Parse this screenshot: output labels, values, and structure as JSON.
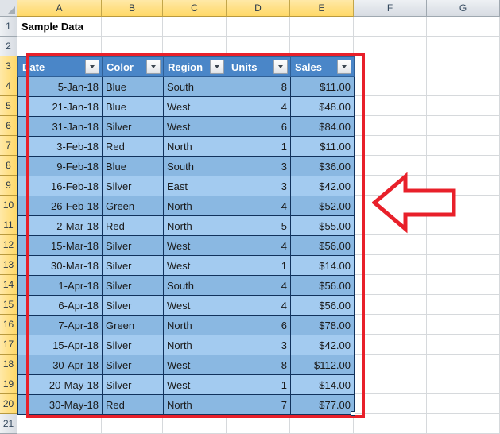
{
  "app": {
    "kind": "spreadsheet",
    "select_all_icon": "select-all-triangle-icon"
  },
  "grid": {
    "column_headers": [
      "A",
      "B",
      "C",
      "D",
      "E",
      "F",
      "G"
    ],
    "selected_columns": [
      "A",
      "B",
      "C",
      "D",
      "E"
    ],
    "row_headers": [
      "1",
      "2",
      "3",
      "4",
      "5",
      "6",
      "7",
      "8",
      "9",
      "10",
      "11",
      "12",
      "13",
      "14",
      "15",
      "16",
      "17",
      "18",
      "19",
      "20",
      "21"
    ],
    "selected_rows": [
      "3",
      "4",
      "5",
      "6",
      "7",
      "8",
      "9",
      "10",
      "11",
      "12",
      "13",
      "14",
      "15",
      "16",
      "17",
      "18",
      "19",
      "20"
    ]
  },
  "title_cell": {
    "ref": "A1",
    "text": "Sample Data"
  },
  "table": {
    "range": "A3:E20",
    "headers": [
      "Date",
      "Color",
      "Region",
      "Units",
      "Sales"
    ],
    "filter_icon": "filter-dropdown-icon",
    "rows": [
      {
        "row": "4",
        "date": "5-Jan-18",
        "color": "Blue",
        "region": "South",
        "units": "8",
        "sales": "$11.00"
      },
      {
        "row": "5",
        "date": "21-Jan-18",
        "color": "Blue",
        "region": "West",
        "units": "4",
        "sales": "$48.00"
      },
      {
        "row": "6",
        "date": "31-Jan-18",
        "color": "Silver",
        "region": "West",
        "units": "6",
        "sales": "$84.00"
      },
      {
        "row": "7",
        "date": "3-Feb-18",
        "color": "Red",
        "region": "North",
        "units": "1",
        "sales": "$11.00"
      },
      {
        "row": "8",
        "date": "9-Feb-18",
        "color": "Blue",
        "region": "South",
        "units": "3",
        "sales": "$36.00"
      },
      {
        "row": "9",
        "date": "16-Feb-18",
        "color": "Silver",
        "region": "East",
        "units": "3",
        "sales": "$42.00"
      },
      {
        "row": "10",
        "date": "26-Feb-18",
        "color": "Green",
        "region": "North",
        "units": "4",
        "sales": "$52.00"
      },
      {
        "row": "11",
        "date": "2-Mar-18",
        "color": "Red",
        "region": "North",
        "units": "5",
        "sales": "$55.00"
      },
      {
        "row": "12",
        "date": "15-Mar-18",
        "color": "Silver",
        "region": "West",
        "units": "4",
        "sales": "$56.00"
      },
      {
        "row": "13",
        "date": "30-Mar-18",
        "color": "Silver",
        "region": "West",
        "units": "1",
        "sales": "$14.00"
      },
      {
        "row": "14",
        "date": "1-Apr-18",
        "color": "Silver",
        "region": "South",
        "units": "4",
        "sales": "$56.00"
      },
      {
        "row": "15",
        "date": "6-Apr-18",
        "color": "Silver",
        "region": "West",
        "units": "4",
        "sales": "$56.00"
      },
      {
        "row": "16",
        "date": "7-Apr-18",
        "color": "Green",
        "region": "North",
        "units": "6",
        "sales": "$78.00"
      },
      {
        "row": "17",
        "date": "15-Apr-18",
        "color": "Silver",
        "region": "North",
        "units": "3",
        "sales": "$42.00"
      },
      {
        "row": "18",
        "date": "30-Apr-18",
        "color": "Silver",
        "region": "West",
        "units": "8",
        "sales": "$112.00"
      },
      {
        "row": "19",
        "date": "20-May-18",
        "color": "Silver",
        "region": "West",
        "units": "1",
        "sales": "$14.00"
      },
      {
        "row": "20",
        "date": "30-May-18",
        "color": "Red",
        "region": "North",
        "units": "7",
        "sales": "$77.00"
      }
    ]
  },
  "annotations": {
    "highlight_box": {
      "label": "red-highlight-rectangle",
      "color": "#e8202a"
    },
    "arrow": {
      "label": "left-pointing-callout-arrow",
      "color": "#e8202a",
      "direction": "left"
    }
  },
  "colors": {
    "header_blue": "#4a86c8",
    "band_dark": "#8ab8e2",
    "band_light": "#a3cbf0",
    "selected_header": "#ffd968",
    "annotation_red": "#e8202a"
  }
}
